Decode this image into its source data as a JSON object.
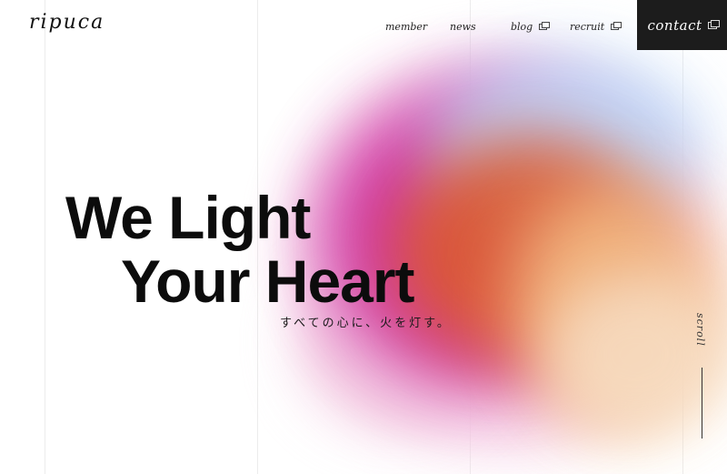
{
  "brand": {
    "logo": "ripuca"
  },
  "nav": {
    "member": "member",
    "news": "news",
    "blog": "blog",
    "recruit": "recruit",
    "contact": "contact"
  },
  "hero": {
    "line1": "We Light",
    "line2": "Your Heart",
    "tagline": "すべての心に、火を灯す。"
  },
  "scroll": {
    "label": "scroll"
  },
  "colors": {
    "contact_bg": "#1c1c1c",
    "blob_magenta": "#c91e9b",
    "blob_orange": "#db5a2f",
    "blob_blue": "#bcd8f8",
    "blob_peach": "#f4bf86"
  },
  "icons": {
    "external_link": "external-link-icon"
  }
}
